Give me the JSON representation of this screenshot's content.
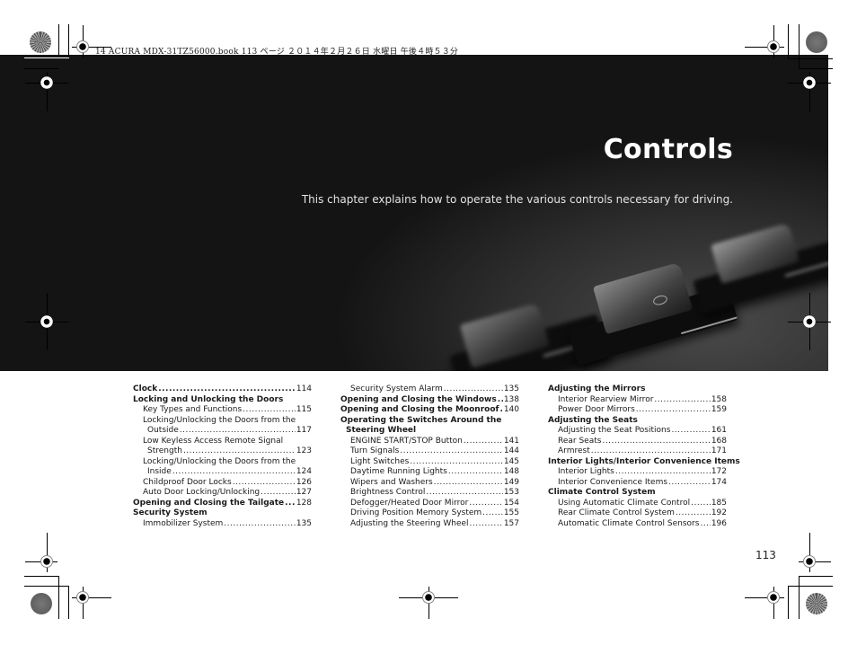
{
  "print_header": "14 ACURA MDX-31TZ56000.book  113 ページ  ２０１４年２月２６日  水曜日  午後４時５３分",
  "chapter": {
    "title": "Controls",
    "subtitle": "This chapter explains how to operate the various controls necessary for driving."
  },
  "toc": {
    "col1": [
      {
        "type": "head",
        "label": "Clock",
        "page": "114"
      },
      {
        "type": "head",
        "label": "Locking and Unlocking the Doors",
        "page": null
      },
      {
        "type": "sub",
        "label": "Key Types and Functions",
        "page": "115"
      },
      {
        "type": "sub",
        "label": "Locking/Unlocking the Doors from the",
        "page": null
      },
      {
        "type": "cont",
        "label": "Outside",
        "page": "117"
      },
      {
        "type": "sub",
        "label": "Low Keyless Access Remote Signal",
        "page": null
      },
      {
        "type": "cont",
        "label": "Strength",
        "page": "123"
      },
      {
        "type": "sub",
        "label": "Locking/Unlocking the Doors from the",
        "page": null
      },
      {
        "type": "cont",
        "label": "Inside",
        "page": "124"
      },
      {
        "type": "sub",
        "label": "Childproof Door Locks",
        "page": "126"
      },
      {
        "type": "sub",
        "label": "Auto Door Locking/Unlocking",
        "page": "127"
      },
      {
        "type": "head",
        "label": "Opening and Closing the Tailgate",
        "page": "128"
      },
      {
        "type": "head",
        "label": "Security System",
        "page": null
      },
      {
        "type": "sub",
        "label": "Immobilizer System",
        "page": "135"
      }
    ],
    "col2": [
      {
        "type": "sub",
        "label": "Security System Alarm",
        "page": "135"
      },
      {
        "type": "head",
        "label": "Opening and Closing the Windows",
        "page": "138"
      },
      {
        "type": "head",
        "label": "Opening and Closing the Moonroof",
        "page": "140"
      },
      {
        "type": "head",
        "label": "Operating the Switches Around the",
        "page": null
      },
      {
        "type": "headcont",
        "label": "Steering Wheel",
        "page": null
      },
      {
        "type": "sub",
        "label": "ENGINE START/STOP Button",
        "page": "141"
      },
      {
        "type": "sub",
        "label": "Turn Signals",
        "page": "144"
      },
      {
        "type": "sub",
        "label": "Light Switches",
        "page": "145"
      },
      {
        "type": "sub",
        "label": "Daytime Running Lights",
        "page": "148"
      },
      {
        "type": "sub",
        "label": "Wipers and Washers",
        "page": "149"
      },
      {
        "type": "sub",
        "label": "Brightness Control",
        "page": "153"
      },
      {
        "type": "sub",
        "label": "Defogger/Heated Door Mirror",
        "page": "154"
      },
      {
        "type": "sub",
        "label": "Driving Position Memory System",
        "page": "155"
      },
      {
        "type": "sub",
        "label": "Adjusting the Steering Wheel",
        "page": "157"
      }
    ],
    "col3": [
      {
        "type": "head",
        "label": "Adjusting the Mirrors",
        "page": null
      },
      {
        "type": "sub",
        "label": "Interior Rearview Mirror",
        "page": "158"
      },
      {
        "type": "sub",
        "label": "Power Door Mirrors",
        "page": "159"
      },
      {
        "type": "head",
        "label": "Adjusting the Seats",
        "page": null
      },
      {
        "type": "sub",
        "label": "Adjusting the Seat Positions",
        "page": "161"
      },
      {
        "type": "sub",
        "label": "Rear Seats",
        "page": "168"
      },
      {
        "type": "sub",
        "label": "Armrest",
        "page": "171"
      },
      {
        "type": "head",
        "label": "Interior Lights/Interior Convenience Items",
        "page": null
      },
      {
        "type": "sub",
        "label": "Interior Lights",
        "page": "172"
      },
      {
        "type": "sub",
        "label": "Interior Convenience Items",
        "page": "174"
      },
      {
        "type": "head",
        "label": "Climate Control System",
        "page": null
      },
      {
        "type": "sub",
        "label": "Using Automatic Climate Control",
        "page": "185"
      },
      {
        "type": "sub",
        "label": "Rear Climate Control System",
        "page": "192"
      },
      {
        "type": "sub",
        "label": "Automatic Climate Control Sensors",
        "page": "196"
      }
    ]
  },
  "page_number": "113"
}
